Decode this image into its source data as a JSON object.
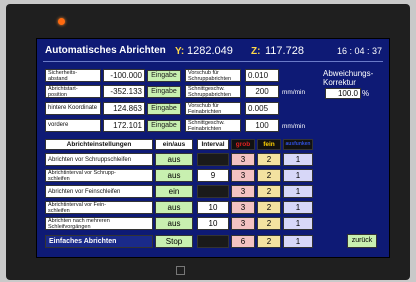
{
  "header": {
    "title": "Automatisches Abrichten",
    "y_label": "Y:",
    "y_value": "1282.049",
    "z_label": "Z:",
    "z_value": "117.728",
    "time": "16 : 04 : 37"
  },
  "params_left": [
    {
      "label": "Sicherheits-\nabstand",
      "value": "-100.000",
      "button": "Eingabe"
    },
    {
      "label": "Abrichtstart-\nposition",
      "value": "-352.133",
      "button": "Eingabe"
    },
    {
      "label": "hintere Koordinate",
      "value": "124.863",
      "button": "Eingabe"
    },
    {
      "label": "vordere Koordinate",
      "value": "172.101",
      "button": "Eingabe"
    }
  ],
  "params_right": [
    {
      "label": "Vorschub für\nSchruppabrichten",
      "value": "0.010",
      "unit": ""
    },
    {
      "label": "Schnittgeschw.\nSchruppabrichten",
      "value": "200",
      "unit": "mm/min"
    },
    {
      "label": "Vorschub für\nFeinabrichten",
      "value": "0.005",
      "unit": ""
    },
    {
      "label": "Schnittgeschw.\nFeinabrichten",
      "value": "100",
      "unit": "mm/min"
    }
  ],
  "correction": {
    "label": "Abweichungs-\nKorrektur",
    "value": "100.0",
    "unit": "%"
  },
  "table": {
    "headers": [
      "Abrichteinstellungen",
      "ein/aus",
      "Interval",
      "grob",
      "fein",
      "ausfunken"
    ],
    "rows": [
      {
        "label": "Abrichten vor Schruppschleifen",
        "state": "aus",
        "interval": "",
        "grob": "3",
        "fein": "2",
        "aus": "1"
      },
      {
        "label": "Abrichtinterval vor Schrupp-\nschleifen",
        "state": "aus",
        "interval": "9",
        "grob": "3",
        "fein": "2",
        "aus": "1"
      },
      {
        "label": "Abrichten vor Feinschleifen",
        "state": "ein",
        "interval": "",
        "grob": "3",
        "fein": "2",
        "aus": "1"
      },
      {
        "label": "Abrichtinterval vor Fein-\nschleifen",
        "state": "aus",
        "interval": "10",
        "grob": "3",
        "fein": "2",
        "aus": "1"
      },
      {
        "label": "Abrichten nach mehreren\nSchleifvorgängen",
        "state": "aus",
        "interval": "10",
        "grob": "3",
        "fein": "2",
        "aus": "1"
      }
    ]
  },
  "bottom": {
    "label": "Einfaches Abrichten",
    "stop": "Stop",
    "grob": "6",
    "fein": "2",
    "aus": "1",
    "back": "zurück"
  },
  "colors": {
    "screen": "#0e1a75",
    "button": "#c8f0b0",
    "grob": "#f3c2c2",
    "fein": "#f3e2a0",
    "aus": "#d7d7f8",
    "header_grob": "#c02020",
    "header_fein": "#e0c000",
    "header_aus": "#2040c0"
  }
}
